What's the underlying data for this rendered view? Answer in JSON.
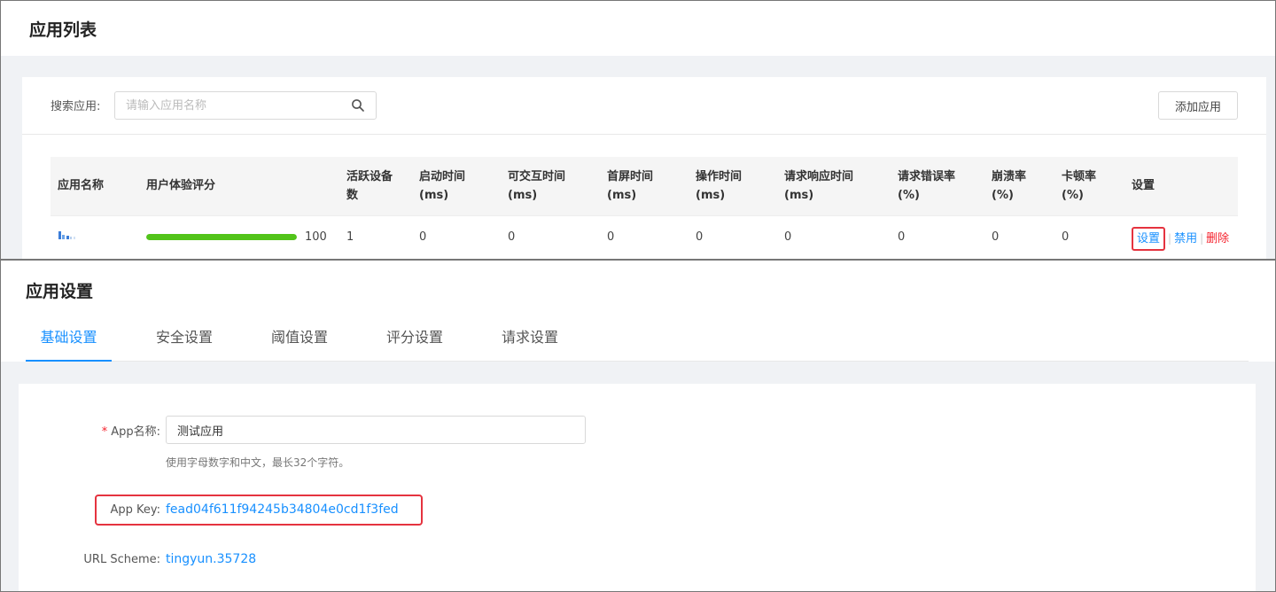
{
  "app_list": {
    "title": "应用列表",
    "search": {
      "label": "搜索应用:",
      "placeholder": "请输入应用名称",
      "icon": "search-icon"
    },
    "add_button": "添加应用",
    "columns": [
      [
        "应用名称"
      ],
      [
        "用户体验评分"
      ],
      [
        "活跃设备",
        "数"
      ],
      [
        "启动时间",
        "(ms)"
      ],
      [
        "可交互时间",
        "(ms)"
      ],
      [
        "首屏时间",
        "(ms)"
      ],
      [
        "操作时间",
        "(ms)"
      ],
      [
        "请求响应时间",
        "(ms)"
      ],
      [
        "请求错误率",
        "(%)"
      ],
      [
        "崩溃率",
        "(%)"
      ],
      [
        "卡顿率",
        "(%)"
      ],
      [
        "设置"
      ]
    ],
    "rows": [
      {
        "score": 100,
        "score_fraction": 1.0,
        "score_color": "#52c41a",
        "active_devices": "1",
        "startup_time": "0",
        "interactive_time": "0",
        "first_screen_time": "0",
        "operation_time": "0",
        "response_time": "0",
        "error_rate": "0",
        "crash_rate": "0",
        "lag_rate": "0",
        "actions": {
          "settings": "设置",
          "disable": "禁用",
          "delete": "删除",
          "separator": "|"
        }
      }
    ]
  },
  "app_settings": {
    "title": "应用设置",
    "tabs": [
      {
        "label": "基础设置",
        "active": true
      },
      {
        "label": "安全设置",
        "active": false
      },
      {
        "label": "阈值设置",
        "active": false
      },
      {
        "label": "评分设置",
        "active": false
      },
      {
        "label": "请求设置",
        "active": false
      }
    ],
    "form": {
      "required_mark": "*",
      "app_name_label": "App名称:",
      "app_name_value": "测试应用",
      "app_name_hint": "使用字母数字和中文，最长32个字符。",
      "app_key_label": "App Key:",
      "app_key_value": "fead04f611f94245b34804e0cd1f3fed",
      "url_scheme_label": "URL Scheme:",
      "url_scheme_value": "tingyun.35728"
    }
  },
  "colors": {
    "accent": "#1890ff",
    "danger": "#f5222d",
    "highlight_border": "#e5333f",
    "success": "#52c41a"
  }
}
